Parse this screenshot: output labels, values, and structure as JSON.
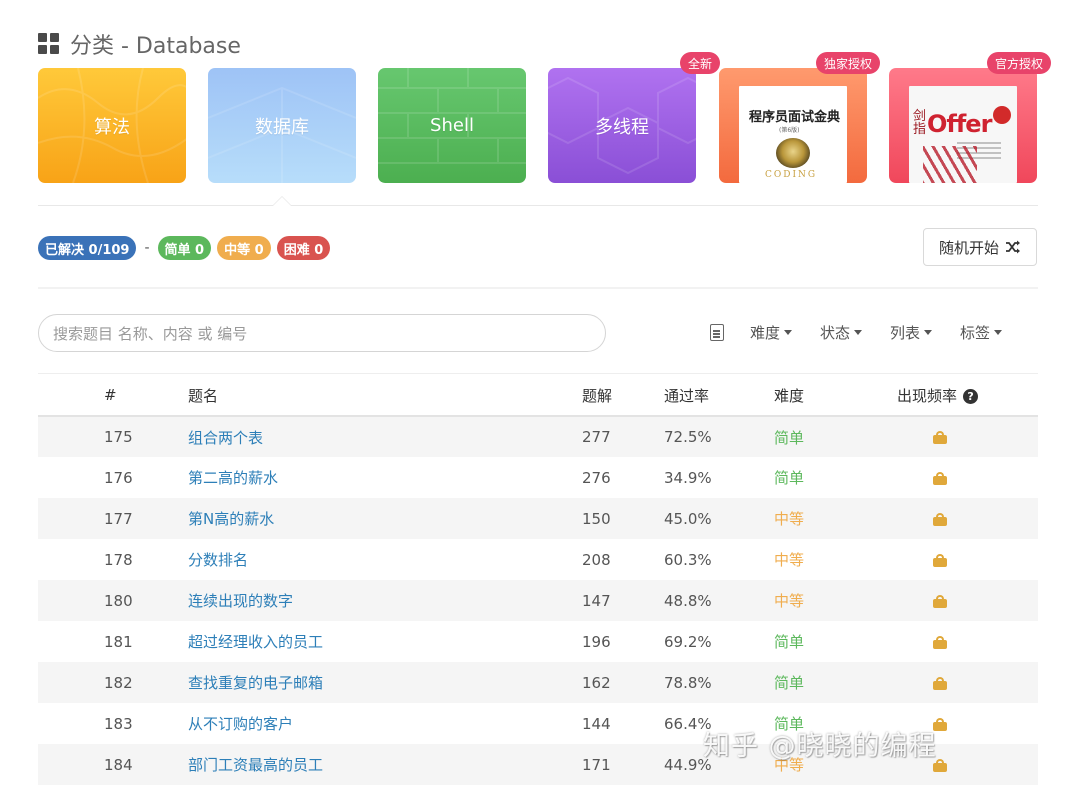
{
  "header": {
    "title": "分类 - Database",
    "icon": "grid-icon"
  },
  "categories": [
    {
      "label": "算法"
    },
    {
      "label": "数据库"
    },
    {
      "label": "Shell"
    },
    {
      "label": "多线程",
      "tag": "全新"
    },
    {
      "label": "",
      "tag": "独家授权",
      "book_title": "程序员面试金典",
      "book_sub": "(第6版)",
      "book_bottom": "CODING"
    },
    {
      "label": "",
      "tag": "官方授权",
      "book_title_a": "剑指",
      "book_title_b": "Offer"
    }
  ],
  "stats": {
    "solved": "已解决 0/109",
    "separator": "-",
    "easy": "简单 0",
    "medium": "中等 0",
    "hard": "困难 0"
  },
  "random_button": {
    "label": "随机开始",
    "icon": "shuffle-icon"
  },
  "search": {
    "placeholder": "搜索题目 名称、内容 或 编号"
  },
  "filters": {
    "difficulty": "难度",
    "status": "状态",
    "list": "列表",
    "tags": "标签"
  },
  "table": {
    "headers": {
      "num": "#",
      "title": "题名",
      "solutions": "题解",
      "rate": "通过率",
      "difficulty": "难度",
      "frequency": "出现频率"
    },
    "rows": [
      {
        "num": "175",
        "title": "组合两个表",
        "solutions": "277",
        "rate": "72.5%",
        "difficulty": "简单",
        "level": "easy"
      },
      {
        "num": "176",
        "title": "第二高的薪水",
        "solutions": "276",
        "rate": "34.9%",
        "difficulty": "简单",
        "level": "easy"
      },
      {
        "num": "177",
        "title": "第N高的薪水",
        "solutions": "150",
        "rate": "45.0%",
        "difficulty": "中等",
        "level": "medium"
      },
      {
        "num": "178",
        "title": "分数排名",
        "solutions": "208",
        "rate": "60.3%",
        "difficulty": "中等",
        "level": "medium"
      },
      {
        "num": "180",
        "title": "连续出现的数字",
        "solutions": "147",
        "rate": "48.8%",
        "difficulty": "中等",
        "level": "medium"
      },
      {
        "num": "181",
        "title": "超过经理收入的员工",
        "solutions": "196",
        "rate": "69.2%",
        "difficulty": "简单",
        "level": "easy"
      },
      {
        "num": "182",
        "title": "查找重复的电子邮箱",
        "solutions": "162",
        "rate": "78.8%",
        "difficulty": "简单",
        "level": "easy"
      },
      {
        "num": "183",
        "title": "从不订购的客户",
        "solutions": "144",
        "rate": "66.4%",
        "difficulty": "简单",
        "level": "easy"
      },
      {
        "num": "184",
        "title": "部门工资最高的员工",
        "solutions": "171",
        "rate": "44.9%",
        "difficulty": "中等",
        "level": "medium"
      }
    ]
  },
  "watermark": "知乎 @晓晓的编程",
  "colors": {
    "link": "#2d7fb8",
    "easy": "#5cb85c",
    "medium": "#f0ad4e",
    "hard": "#d9534f",
    "solved": "#3a72b8",
    "lock": "#e0a83a",
    "tag": "#e8436a"
  }
}
